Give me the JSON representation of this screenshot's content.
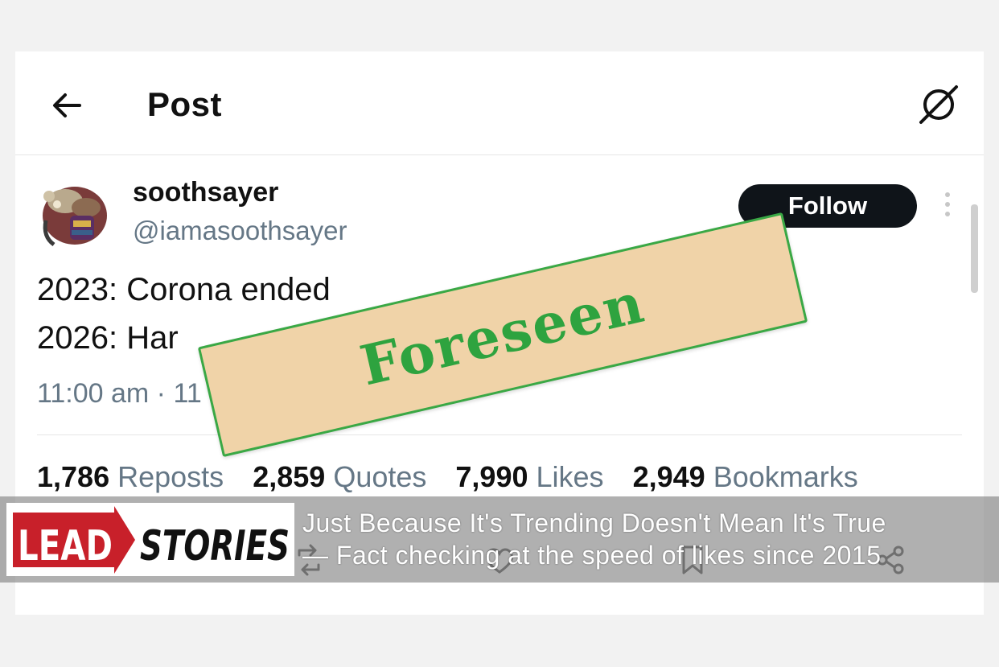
{
  "header": {
    "title": "Post"
  },
  "author": {
    "display_name": "soothsayer",
    "handle": "@iamasoothsayer"
  },
  "follow_button": {
    "label": "Follow"
  },
  "post": {
    "line1": "2023: Corona ended",
    "line2": "2026: Har",
    "timestamp": "11:00 am · 11"
  },
  "stats": [
    {
      "count": "1,786",
      "label": "Reposts"
    },
    {
      "count": "2,859",
      "label": "Quotes"
    },
    {
      "count": "7,990",
      "label": "Likes"
    },
    {
      "count": "2,949",
      "label": "Bookmarks"
    }
  ],
  "stamp": {
    "text": "Foreseen"
  },
  "banner": {
    "logo_text_left": "LEAD",
    "logo_text_right": "STORIES",
    "tagline1": "Just Because It's Trending Doesn't Mean It's True",
    "tagline2": "— Fact checking at the speed of likes since 2015"
  },
  "icons": {
    "back": "arrow-left-icon",
    "grok": "grok-icon",
    "more": "more-vertical-icon",
    "repost": "repost-icon",
    "like": "heart-icon",
    "bookmark": "bookmark-icon",
    "share": "share-icon"
  },
  "colors": {
    "follow_bg": "#0f1419",
    "stamp_bg": "#f0d3a8",
    "stamp_green": "#2ea33f",
    "logo_red": "#c8202a",
    "muted_text": "#657786"
  }
}
